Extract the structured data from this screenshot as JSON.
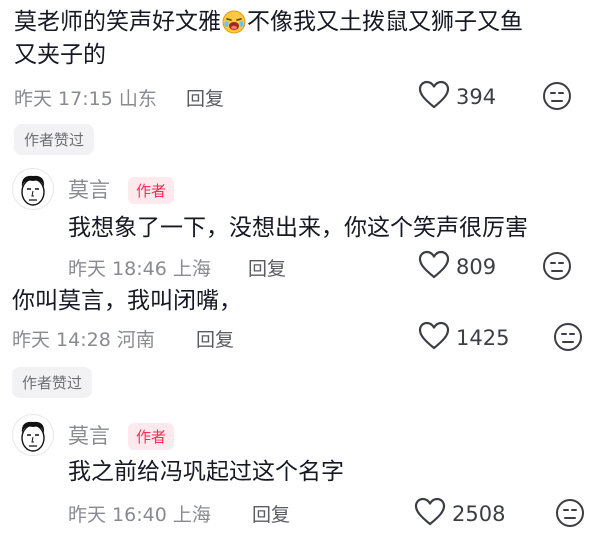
{
  "comments": [
    {
      "text_a": "莫老师的笑声好文雅",
      "text_b": "不像我又土拨鼠又狮子又鱼",
      "text_line2": "又夹子的",
      "time": "昨天 17:15 山东",
      "reply_label": "回复",
      "likes": "394",
      "author_liked": "作者赞过",
      "emoji_icon": "laughing-crying-emoji"
    },
    {
      "author": "莫言",
      "author_badge": "作者",
      "text": "我想象了一下，没想出来，你这个笑声很厉害",
      "time": "昨天 18:46 上海",
      "reply_label": "回复",
      "likes": "809"
    },
    {
      "text": "你叫莫言，我叫闭嘴，",
      "time": "昨天 14:28 河南",
      "reply_label": "回复",
      "likes": "1425",
      "author_liked": "作者赞过"
    },
    {
      "author": "莫言",
      "author_badge": "作者",
      "text": "我之前给冯巩起过这个名字",
      "time": "昨天 16:40 上海",
      "reply_label": "回复",
      "likes": "2508"
    }
  ],
  "colors": {
    "accent": "#fe2c55",
    "text": "#161823",
    "meta": "#8a8b91"
  }
}
